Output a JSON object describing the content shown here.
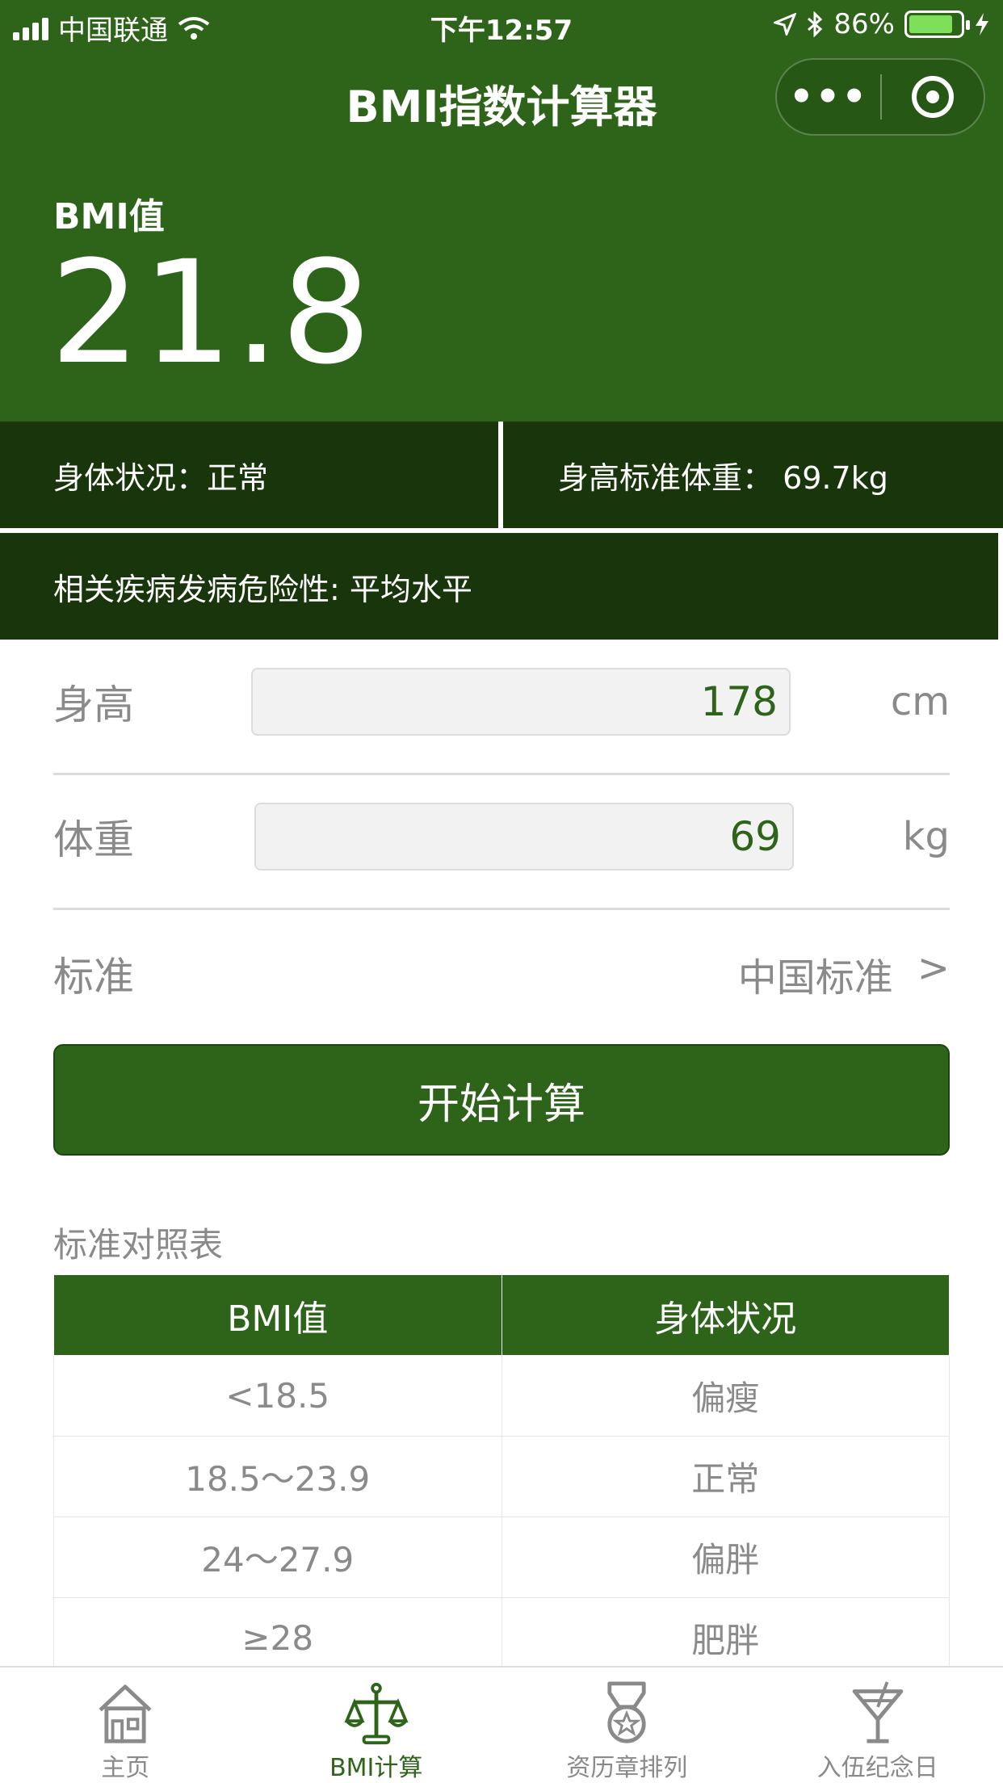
{
  "status_bar": {
    "carrier": "中国联通",
    "time": "下午12:57",
    "battery": "86%",
    "battery_level": 0.86
  },
  "nav": {
    "title": "BMI指数计算器",
    "more_icon": "more-dots-icon",
    "close_icon": "target-icon"
  },
  "result": {
    "label": "BMI值",
    "value": "21.8",
    "body_status": "身体状况：正常",
    "standard_weight": "身高标准体重：  69.7kg",
    "risk": "相关疾病发病危险性: 平均水平"
  },
  "form": {
    "height_label": "身高",
    "height_value": "178",
    "height_unit": "cm",
    "weight_label": "体重",
    "weight_value": "69",
    "weight_unit": "kg",
    "standard_label": "标准",
    "standard_value": "中国标准",
    "standard_arrow": ">"
  },
  "calc_button": "开始计算",
  "table": {
    "title": "标准对照表",
    "headers": [
      "BMI值",
      "身体状况"
    ],
    "rows": [
      [
        "<18.5",
        "偏瘦"
      ],
      [
        "18.5～23.9",
        "正常"
      ],
      [
        "24～27.9",
        "偏胖"
      ],
      [
        "≥28",
        "肥胖"
      ]
    ]
  },
  "tabbar": {
    "items": [
      {
        "label": "主页",
        "icon": "house-icon"
      },
      {
        "label": "BMI计算",
        "icon": "scale-icon"
      },
      {
        "label": "资历章排列",
        "icon": "medal-icon"
      },
      {
        "label": "入伍纪念日",
        "icon": "cocktail-icon"
      }
    ],
    "active_index": 1
  },
  "colors": {
    "primary": "#2d6419",
    "dark": "#18350c",
    "muted": "#8a8a8a"
  }
}
